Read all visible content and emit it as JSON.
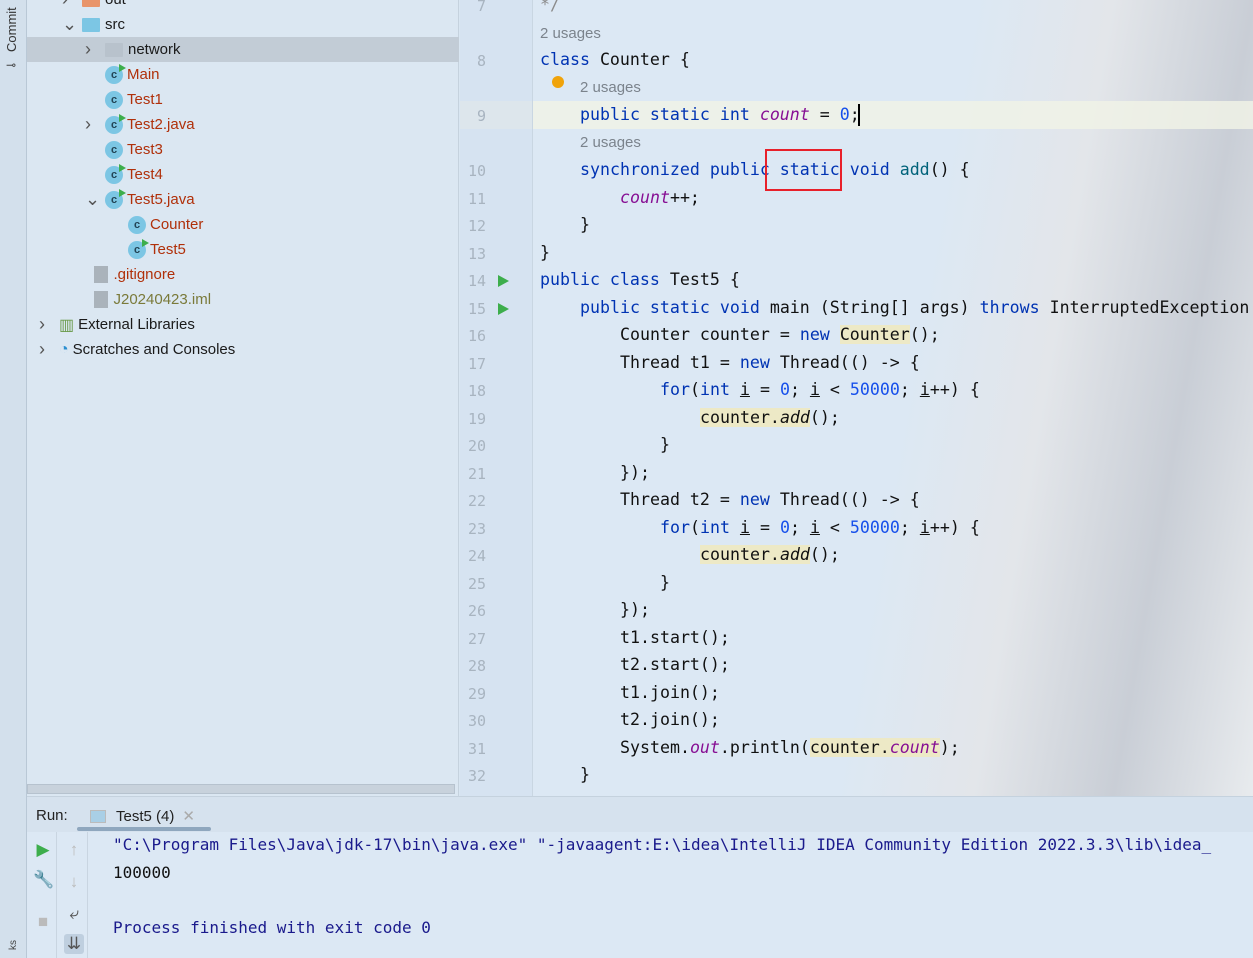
{
  "sidebar_strip": {
    "commit_label": "Commit",
    "bottom_label": "ks"
  },
  "project_tree": {
    "items": [
      {
        "label": "out",
        "type": "folder-orange",
        "depth": 1,
        "chev": ">"
      },
      {
        "label": "src",
        "type": "folder",
        "depth": 1,
        "chev": "v"
      },
      {
        "label": "network",
        "type": "folder-grey",
        "depth": 2,
        "chev": ">",
        "selected": true
      },
      {
        "label": "Main",
        "type": "class-run",
        "depth": 2,
        "color": "red"
      },
      {
        "label": "Test1",
        "type": "class",
        "depth": 2,
        "color": "red"
      },
      {
        "label": "Test2.java",
        "type": "class-run",
        "depth": 2,
        "chev": ">",
        "color": "red"
      },
      {
        "label": "Test3",
        "type": "class",
        "depth": 2,
        "color": "red"
      },
      {
        "label": "Test4",
        "type": "class-run",
        "depth": 2,
        "color": "red"
      },
      {
        "label": "Test5.java",
        "type": "class-run",
        "depth": 2,
        "chev": "v",
        "color": "red"
      },
      {
        "label": "Counter",
        "type": "class",
        "depth": 3,
        "color": "red"
      },
      {
        "label": "Test5",
        "type": "class-run",
        "depth": 3,
        "color": "red"
      },
      {
        "label": ".gitignore",
        "type": "file",
        "depth": 1.5,
        "color": "red"
      },
      {
        "label": "J20240423.iml",
        "type": "file",
        "depth": 1.5,
        "color": "olive"
      },
      {
        "label": "External Libraries",
        "type": "libs",
        "depth": 0,
        "chev": ">"
      },
      {
        "label": "Scratches and Consoles",
        "type": "scratch",
        "depth": 0,
        "chev": ">"
      }
    ]
  },
  "editor": {
    "usages_label": "2 usages",
    "lines": [
      {
        "n": "7",
        "indent": 0,
        "tokens": [
          [
            "*/",
            "cm"
          ]
        ]
      },
      {
        "usage": true,
        "indent": 0
      },
      {
        "n": "8",
        "indent": 0,
        "tokens": [
          [
            "class",
            "kw"
          ],
          [
            " Counter {",
            ""
          ]
        ]
      },
      {
        "usage": true,
        "indent": 4
      },
      {
        "n": "9",
        "indent": 4,
        "tokens": [
          [
            "public static int ",
            "kw"
          ],
          [
            "count",
            "fld"
          ],
          [
            " = ",
            ""
          ],
          [
            "0",
            "num"
          ],
          [
            ";",
            ""
          ]
        ]
      },
      {
        "usage": true,
        "indent": 4
      },
      {
        "n": "10",
        "indent": 4,
        "tokens": [
          [
            "synchronized public static void ",
            "kw"
          ],
          [
            "add",
            "fn"
          ],
          [
            "() {",
            ""
          ]
        ]
      },
      {
        "n": "11",
        "indent": 8,
        "tokens": [
          [
            "count",
            "fld"
          ],
          [
            "++;",
            ""
          ]
        ]
      },
      {
        "n": "12",
        "indent": 4,
        "tokens": [
          [
            "}",
            ""
          ]
        ]
      },
      {
        "n": "13",
        "indent": 0,
        "tokens": [
          [
            "}",
            ""
          ]
        ]
      },
      {
        "n": "14",
        "indent": 0,
        "run": true,
        "tokens": [
          [
            "public class ",
            "kw"
          ],
          [
            "Test5 {",
            ""
          ]
        ]
      },
      {
        "n": "15",
        "indent": 4,
        "run": true,
        "tokens": [
          [
            "public static void ",
            "kw"
          ],
          [
            "main",
            ""
          ],
          [
            " (String[] args) ",
            ""
          ],
          [
            "throws",
            "kw"
          ],
          [
            " InterruptedException",
            ""
          ]
        ]
      },
      {
        "n": "16",
        "indent": 8,
        "tokens": [
          [
            "Counter counter = ",
            ""
          ],
          [
            "new",
            "kw"
          ],
          [
            " ",
            ""
          ],
          [
            "Counter",
            "hl"
          ],
          [
            "();",
            ""
          ]
        ]
      },
      {
        "n": "17",
        "indent": 8,
        "tokens": [
          [
            "Thread t1 = ",
            ""
          ],
          [
            "new",
            "kw"
          ],
          [
            " Thread(() -> {",
            ""
          ]
        ]
      },
      {
        "n": "18",
        "indent": 12,
        "tokens": [
          [
            "for",
            "kw"
          ],
          [
            "(",
            ""
          ],
          [
            "int",
            "kw"
          ],
          [
            " ",
            ""
          ],
          [
            "i",
            "ul"
          ],
          [
            " = ",
            ""
          ],
          [
            "0",
            "num"
          ],
          [
            "; ",
            ""
          ],
          [
            "i",
            "ul"
          ],
          [
            " < ",
            ""
          ],
          [
            "50000",
            "num"
          ],
          [
            "; ",
            ""
          ],
          [
            "i",
            "ul"
          ],
          [
            "++) {",
            ""
          ]
        ]
      },
      {
        "n": "19",
        "indent": 16,
        "tokens": [
          [
            "counter.",
            "hl"
          ],
          [
            "add",
            "hl it"
          ],
          [
            "();",
            ""
          ]
        ]
      },
      {
        "n": "20",
        "indent": 12,
        "tokens": [
          [
            "}",
            ""
          ]
        ]
      },
      {
        "n": "21",
        "indent": 8,
        "tokens": [
          [
            "});",
            ""
          ]
        ]
      },
      {
        "n": "22",
        "indent": 8,
        "tokens": [
          [
            "Thread t2 = ",
            ""
          ],
          [
            "new",
            "kw"
          ],
          [
            " Thread(() -> {",
            ""
          ]
        ]
      },
      {
        "n": "23",
        "indent": 12,
        "tokens": [
          [
            "for",
            "kw"
          ],
          [
            "(",
            ""
          ],
          [
            "int",
            "kw"
          ],
          [
            " ",
            ""
          ],
          [
            "i",
            "ul"
          ],
          [
            " = ",
            ""
          ],
          [
            "0",
            "num"
          ],
          [
            "; ",
            ""
          ],
          [
            "i",
            "ul"
          ],
          [
            " < ",
            ""
          ],
          [
            "50000",
            "num"
          ],
          [
            "; ",
            ""
          ],
          [
            "i",
            "ul"
          ],
          [
            "++) {",
            ""
          ]
        ]
      },
      {
        "n": "24",
        "indent": 16,
        "tokens": [
          [
            "counter.",
            "hl"
          ],
          [
            "add",
            "hl it"
          ],
          [
            "();",
            ""
          ]
        ]
      },
      {
        "n": "25",
        "indent": 12,
        "tokens": [
          [
            "}",
            ""
          ]
        ]
      },
      {
        "n": "26",
        "indent": 8,
        "tokens": [
          [
            "});",
            ""
          ]
        ]
      },
      {
        "n": "27",
        "indent": 8,
        "tokens": [
          [
            "t1.start();",
            ""
          ]
        ]
      },
      {
        "n": "28",
        "indent": 8,
        "tokens": [
          [
            "t2.start();",
            ""
          ]
        ]
      },
      {
        "n": "29",
        "indent": 8,
        "tokens": [
          [
            "t1.join();",
            ""
          ]
        ]
      },
      {
        "n": "30",
        "indent": 8,
        "tokens": [
          [
            "t2.join();",
            ""
          ]
        ]
      },
      {
        "n": "31",
        "indent": 8,
        "tokens": [
          [
            "System.",
            ""
          ],
          [
            "out",
            "st"
          ],
          [
            ".println(",
            ""
          ],
          [
            "counter.",
            "hl"
          ],
          [
            "count",
            "hl fld"
          ],
          [
            ");",
            ""
          ]
        ]
      },
      {
        "n": "32",
        "indent": 4,
        "tokens": [
          [
            "}",
            ""
          ]
        ]
      }
    ]
  },
  "run": {
    "label": "Run:",
    "tab": "Test5 (4)"
  },
  "console": {
    "lines": [
      "\"C:\\Program Files\\Java\\jdk-17\\bin\\java.exe\" \"-javaagent:E:\\idea\\IntelliJ IDEA Community Edition 2022.3.3\\lib\\idea_",
      "100000",
      "",
      "Process finished with exit code 0"
    ]
  },
  "colors": {
    "keyword": "#0033b3",
    "field": "#871094",
    "number": "#1750eb",
    "highlight_box": "#e8202a"
  }
}
